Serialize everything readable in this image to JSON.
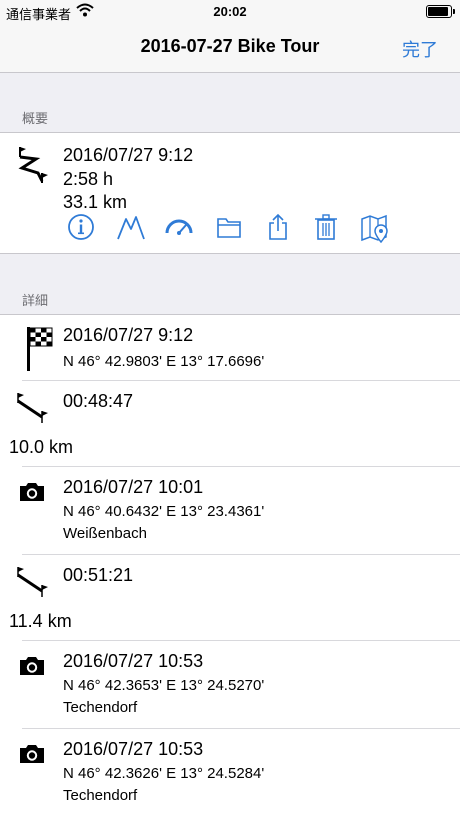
{
  "status_bar": {
    "carrier": "通信事業者",
    "time": "20:02",
    "battery_level": 0.95
  },
  "nav": {
    "title": "2016-07-27 Bike Tour",
    "done_label": "完了"
  },
  "summary": {
    "header": "概要",
    "date": "2016/07/27 9:12",
    "duration": "2:58 h",
    "distance": "33.1 km",
    "actions": [
      "info-icon",
      "elevation-icon",
      "speedometer-icon",
      "folder-icon",
      "share-icon",
      "trash-icon",
      "map-pin-icon"
    ]
  },
  "details": {
    "header": "詳細",
    "start": {
      "date": "2016/07/27 9:12",
      "coords": "N 46° 42.9803' E 13° 17.6696'"
    },
    "segment1": {
      "time": "00:48:47",
      "distance": "10.0 km"
    },
    "photo1": {
      "date": "2016/07/27 10:01",
      "coords": "N 46° 40.6432' E 13° 23.4361'",
      "place": "Weißenbach"
    },
    "segment2": {
      "time": "00:51:21",
      "distance": "11.4 km"
    },
    "photo2": {
      "date": "2016/07/27 10:53",
      "coords": "N 46° 42.3653' E 13° 24.5270'",
      "place": "Techendorf"
    },
    "photo3": {
      "date": "2016/07/27 10:53",
      "coords": "N 46° 42.3626' E 13° 24.5284'",
      "place": "Techendorf"
    }
  },
  "colors": {
    "accent": "#2f7bd6",
    "background": "#efeff4"
  }
}
